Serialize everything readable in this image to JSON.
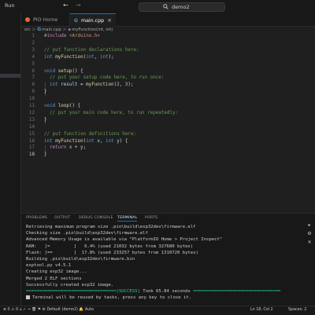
{
  "titlebar": {
    "menu_run": "Run",
    "back_icon": "arrow-left-icon",
    "forward_icon": "arrow-right-icon",
    "search_icon": "search-icon",
    "window_title": "demo2"
  },
  "tabs": [
    {
      "label": "PIO Home",
      "icon": "platformio-icon",
      "active": false
    },
    {
      "label": "main.cpp",
      "icon": "cpp-file-icon",
      "active": true,
      "close": "×"
    }
  ],
  "breadcrumb": {
    "parts": [
      "src",
      "main.cpp",
      "myFunction(int, int)"
    ],
    "separator": ">"
  },
  "editor": {
    "current_line": 18,
    "lines": [
      {
        "n": "1"
      },
      {
        "n": "2"
      },
      {
        "n": "3"
      },
      {
        "n": "4"
      },
      {
        "n": "5"
      },
      {
        "n": "6"
      },
      {
        "n": "7"
      },
      {
        "n": "8"
      },
      {
        "n": "9"
      },
      {
        "n": "10"
      },
      {
        "n": "11"
      },
      {
        "n": "12"
      },
      {
        "n": "13"
      },
      {
        "n": "14"
      },
      {
        "n": "15"
      },
      {
        "n": "16"
      },
      {
        "n": "17"
      },
      {
        "n": "18"
      }
    ],
    "tokens": {
      "l1": [
        "#include",
        " ",
        "<Arduino.h>"
      ],
      "l3": "// put function declarations here:",
      "l4": [
        "int",
        " ",
        "myFunction",
        "(",
        "int",
        ", ",
        "int",
        ");"
      ],
      "l6": [
        "void",
        " ",
        "setup",
        "() {"
      ],
      "l7": "// put your setup code here, to run once:",
      "l8": [
        "int",
        " ",
        "result",
        " = ",
        "myFunction",
        "(",
        "2",
        ", ",
        "3",
        ");"
      ],
      "l9": "}",
      "l11": [
        "void",
        " ",
        "loop",
        "() {"
      ],
      "l12": "// put your main code here, to run repeatedly:",
      "l13": "}",
      "l15": "// put function definitions here:",
      "l16": [
        "int",
        " ",
        "myFunction",
        "(",
        "int",
        " ",
        "x",
        ", ",
        "int",
        " ",
        "y",
        ") {"
      ],
      "l17": [
        "return",
        " ",
        "x",
        " + ",
        "y",
        ";"
      ],
      "l18": "}"
    }
  },
  "panel": {
    "tabs": [
      "PROBLEMS",
      "OUTPUT",
      "DEBUG CONSOLE",
      "TERMINAL",
      "PORTS"
    ],
    "active_tab": "TERMINAL",
    "terminal_lines": [
      "Retrieving maximum program size .pio\\build\\esp32dev\\firmware.elf",
      "Checking size .pio\\build\\esp32dev\\firmware.elf",
      "Advanced Memory Usage is available via \"PlatformIO Home > Project Inspect\"",
      "RAM:   [=         ]   6.4% (used 21032 bytes from 327680 bytes)",
      "Flash: [==        ]  17.8% (used 233257 bytes from 1310720 bytes)",
      "Building .pio\\build\\esp32dev\\firmware.bin",
      "esptool.py v4.5.1",
      "Creating esp32 image...",
      "Merged 2 ELF sections",
      "Successfully created esp32 image."
    ],
    "success_rule_left": "==================================",
    "success_tag": "[SUCCESS]",
    "success_text": " Took 65.84 seconds ",
    "success_rule_right": "=================================",
    "reuse_text": "Terminal will be reused by tasks, press any key to close it.",
    "side_icons": [
      "terminal-icon",
      "gear-icon",
      "close-icon"
    ],
    "colors": {
      "success": "#23d18b"
    }
  },
  "statusbar": {
    "left": "⊗ 0 ⚠ 0   ⌂  ✓  →  🗑  ⚑  ⚙ Default (demo2)    🔔 Auto",
    "position": "Ln 18, Col 2",
    "spaces": "Spaces: 2"
  },
  "colors": {
    "accent": "#0078d4",
    "editor_bg": "#1f1f1f",
    "chrome_bg": "#181818"
  }
}
